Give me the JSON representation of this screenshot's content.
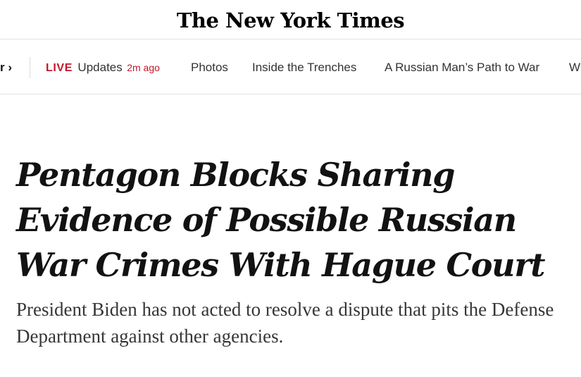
{
  "masthead": {
    "logo_text": "The New York Times"
  },
  "subnav": {
    "prev_item": "r ›",
    "live": {
      "label": "LIVE",
      "text": "Updates",
      "time": "2m ago"
    },
    "items": [
      {
        "label": "Photos"
      },
      {
        "label": "Inside the Trenches"
      },
      {
        "label": "A Russian Man’s Path to War"
      },
      {
        "label": "W"
      }
    ]
  },
  "article": {
    "headline": "Pentagon Blocks Sharing Evidence of Possible Russian War Crimes With Hague Court",
    "summary": "President Biden has not acted to resolve a dispute that pits the Defense Department against other agencies."
  },
  "colors": {
    "live_red": "#c1172c",
    "text_primary": "#121212",
    "text_secondary": "#363636",
    "divider": "#e2e2e2"
  }
}
